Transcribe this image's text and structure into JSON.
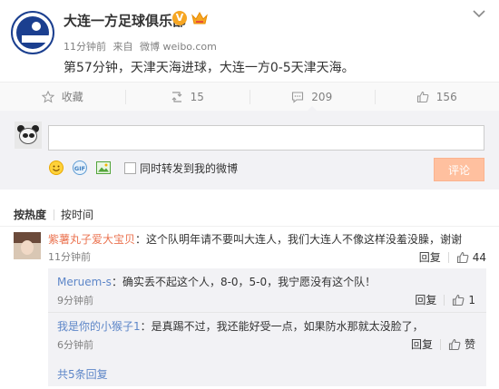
{
  "post": {
    "author": "大连一方足球俱乐部",
    "time": "11分钟前",
    "source_prefix": "来自",
    "source": "微博 weibo.com",
    "text": "第57分钟，天津天海进球，大连一方0-5天津天海。"
  },
  "actions": {
    "favorite": "收藏",
    "repost_count": "15",
    "comment_count": "209",
    "like_count": "156"
  },
  "compose": {
    "input_value": "",
    "repost_label": "同时转发到我的微博",
    "submit_label": "评论"
  },
  "sort": {
    "hot": "按热度",
    "time": "按时间"
  },
  "comment": {
    "user": "紫薯丸子爱大宝贝",
    "text": "：这个队明年请不要叫大连人，我们大连人不像这样没羞没臊，谢谢",
    "time": "11分钟前",
    "reply_label": "回复",
    "like_count": "44"
  },
  "replies": [
    {
      "user": "Meruem-s",
      "text": "：确实丢不起这个人，8-0，5-0，我宁愿没有这个队！",
      "time": "9分钟前",
      "reply_label": "回复",
      "like_label": "1"
    },
    {
      "user": "我是你的小猴子1",
      "text": "：是真踢不过，我还能好受一点，如果防水那就太没脸了，",
      "time": "6分钟前",
      "reply_label": "回复",
      "like_label": "赞"
    }
  ],
  "more_replies": "共5条回复",
  "colors": {
    "link": "#eb7350",
    "submit_disabled": "#ffc09f",
    "panel": "#f2f2f5"
  }
}
